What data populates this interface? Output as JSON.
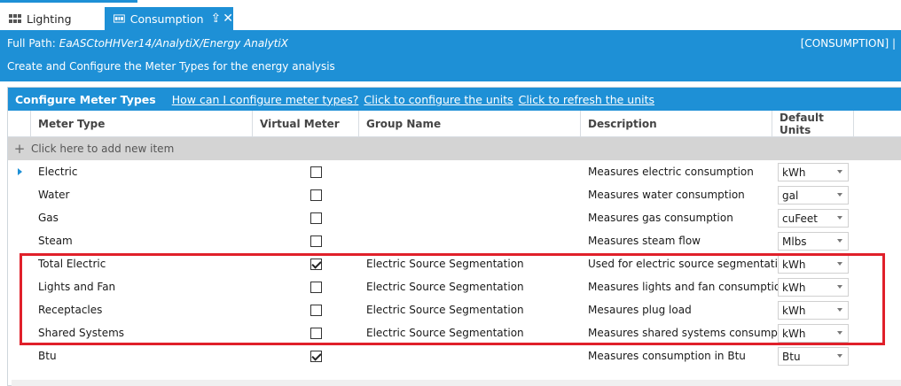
{
  "tabs": [
    {
      "label": "Lighting"
    },
    {
      "label": "Consumption"
    }
  ],
  "header": {
    "full_path_label": "Full Path:",
    "full_path_value": "EaASCtoHHVer14/AnalytiX/Energy AnalytiX",
    "context_tag": "[CONSUMPTION] |",
    "description": "Create and Configure the Meter Types for the energy analysis"
  },
  "panel": {
    "title": "Configure Meter Types",
    "links": [
      "How can I configure meter types?",
      "Click to configure the units",
      "Click to refresh the units"
    ]
  },
  "grid": {
    "columns": [
      "Meter Type",
      "Virtual Meter",
      "Group Name",
      "Description",
      "Default Units"
    ],
    "add_row_label": "Click here to add new item",
    "rows": [
      {
        "meter_type": "Electric",
        "virtual": false,
        "group": "",
        "description": "Measures electric consumption",
        "units": "kWh"
      },
      {
        "meter_type": "Water",
        "virtual": false,
        "group": "",
        "description": "Measures water consumption",
        "units": "gal"
      },
      {
        "meter_type": "Gas",
        "virtual": false,
        "group": "",
        "description": "Measures gas consumption",
        "units": "cuFeet"
      },
      {
        "meter_type": "Steam",
        "virtual": false,
        "group": "",
        "description": "Measures steam flow",
        "units": "Mlbs"
      },
      {
        "meter_type": "Total Electric",
        "virtual": true,
        "group": "Electric Source Segmentation",
        "description": "Used for electric source segmentation",
        "units": "kWh"
      },
      {
        "meter_type": "Lights and Fan",
        "virtual": false,
        "group": "Electric Source Segmentation",
        "description": "Measures lights and fan consumption",
        "units": "kWh"
      },
      {
        "meter_type": "Receptacles",
        "virtual": false,
        "group": "Electric Source Segmentation",
        "description": "Mesaures plug load",
        "units": "kWh"
      },
      {
        "meter_type": "Shared Systems",
        "virtual": false,
        "group": "Electric Source Segmentation",
        "description": "Measures shared systems consumption",
        "units": "kWh"
      },
      {
        "meter_type": "Btu",
        "virtual": true,
        "group": "",
        "description": "Measures consumption in Btu",
        "units": "Btu"
      }
    ]
  },
  "colors": {
    "accent": "#1e90d6",
    "highlight": "#e0202a"
  },
  "icons": {
    "lighting_tab": "grid-icon",
    "consumption_tab": "meter-icon",
    "pin": "pin-icon",
    "close": "close-icon",
    "add": "plus-icon"
  }
}
